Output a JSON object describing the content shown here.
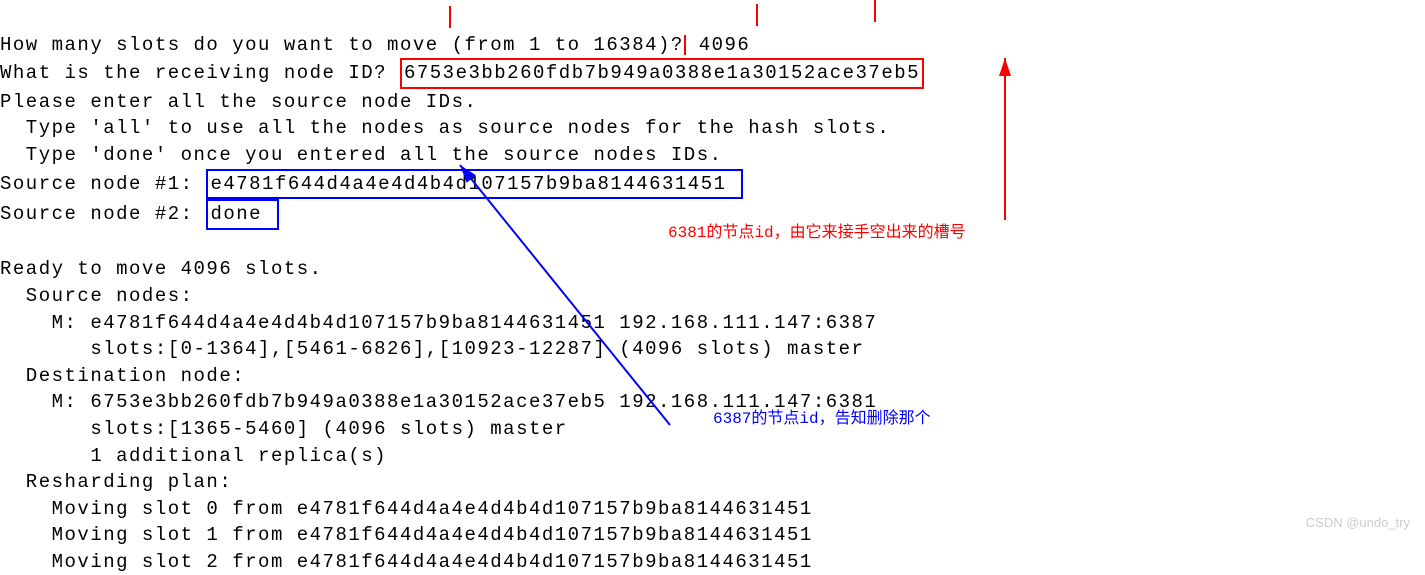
{
  "lines": {
    "l1a": "How many slots do you want to move (from 1 to 16384)?",
    "l1b": " 4096",
    "l2a": "What is the receiving node ID? ",
    "l2b": "6753e3bb260fdb7b949a0388e1a30152ace37eb5",
    "l3": "Please enter all the source node IDs.",
    "l4": "  Type 'all' to use all the nodes as source nodes for the hash slots.",
    "l5": "  Type 'done' once you entered all the source nodes IDs.",
    "l6a": "Source node #1: ",
    "l6b": "e4781f644d4a4e4d4b4d107157b9ba8144631451 ",
    "l7a": "Source node #2: ",
    "l7b": "done ",
    "l8": "",
    "l9": "Ready to move 4096 slots.",
    "l10": "  Source nodes:",
    "l11": "    M: e4781f644d4a4e4d4b4d107157b9ba8144631451 192.168.111.147:6387",
    "l12": "       slots:[0-1364],[5461-6826],[10923-12287] (4096 slots) master",
    "l13": "  Destination node:",
    "l14": "    M: 6753e3bb260fdb7b949a0388e1a30152ace37eb5 192.168.111.147:6381",
    "l15": "       slots:[1365-5460] (4096 slots) master",
    "l16": "       1 additional replica(s)",
    "l17": "  Resharding plan:",
    "l18": "    Moving slot 0 from e4781f644d4a4e4d4b4d107157b9ba8144631451",
    "l19": "    Moving slot 1 from e4781f644d4a4e4d4b4d107157b9ba8144631451",
    "l20": "    Moving slot 2 from e4781f644d4a4e4d4b4d107157b9ba8144631451"
  },
  "annotations": {
    "red": "6381的节点id，由它来接手空出来的槽号",
    "blue": "6387的节点id，告知删除那个"
  },
  "watermark": "CSDN @undo_try"
}
